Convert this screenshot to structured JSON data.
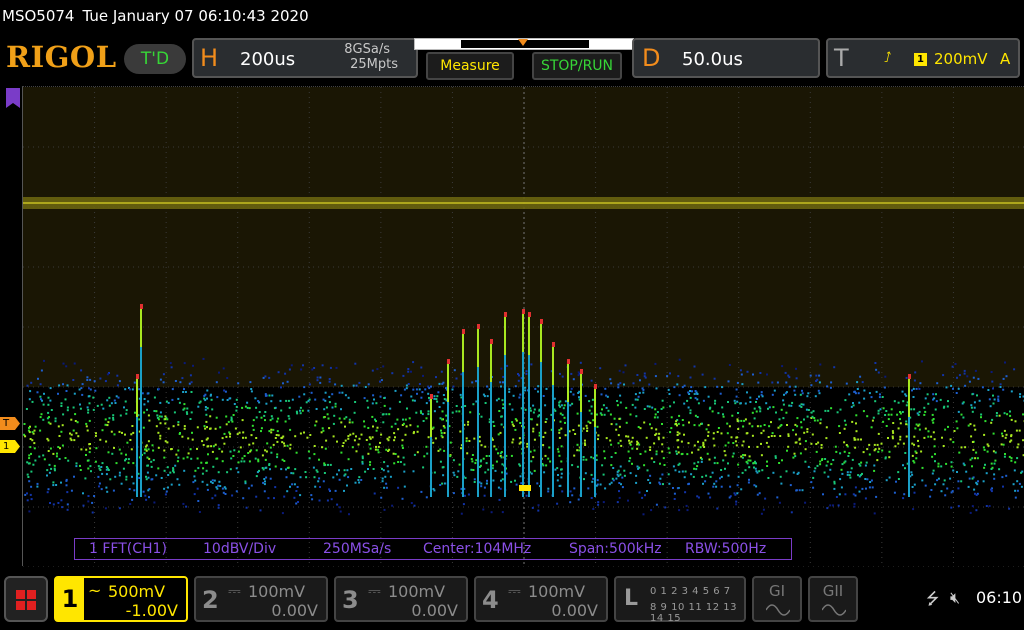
{
  "status": {
    "model": "MSO5074",
    "datetime": "Tue January 07 06:10:43 2020"
  },
  "logo": "RIGOL",
  "run_state": "T'D",
  "horizontal": {
    "letter": "H",
    "timebase": "200us",
    "sample_rate": "8GSa/s",
    "memory_depth": "25Mpts"
  },
  "buttons": {
    "measure": "Measure",
    "stop_run": "STOP/RUN"
  },
  "delay": {
    "letter": "D",
    "value": "50.0us"
  },
  "trigger": {
    "letter": "T",
    "edge_icon": "rising-edge-icon",
    "source": "1",
    "level": "200mV",
    "mode": "A",
    "marker_label": "T"
  },
  "ch1_marker": "1",
  "fft": {
    "channel": "1 FFT(CH1)",
    "scale": "10dBV/Div",
    "rate": "250MSa/s",
    "center": "Center:104MHz",
    "span": "Span:500kHz",
    "rbw": "RBW:500Hz"
  },
  "channels": [
    {
      "num": "1",
      "coupling": "~",
      "scale": "500mV",
      "offset": "-1.00V",
      "color": "#ffe600"
    },
    {
      "num": "2",
      "coupling": "⎓",
      "scale": "100mV",
      "offset": "0.00V",
      "color": "#8c8c8c"
    },
    {
      "num": "3",
      "coupling": "⎓",
      "scale": "100mV",
      "offset": "0.00V",
      "color": "#8c8c8c"
    },
    {
      "num": "4",
      "coupling": "⎓",
      "scale": "100mV",
      "offset": "0.00V",
      "color": "#8c8c8c"
    }
  ],
  "logic": {
    "letter": "L",
    "row1": "0 1 2 3  4 5 6 7",
    "row2": "8 9 10 11 12 13 14 15"
  },
  "generators": [
    {
      "label": "GI"
    },
    {
      "label": "GII"
    }
  ],
  "tray": {
    "usb_icon": "usb-icon",
    "speaker_icon": "speaker-muted-icon",
    "time": "06:10"
  }
}
